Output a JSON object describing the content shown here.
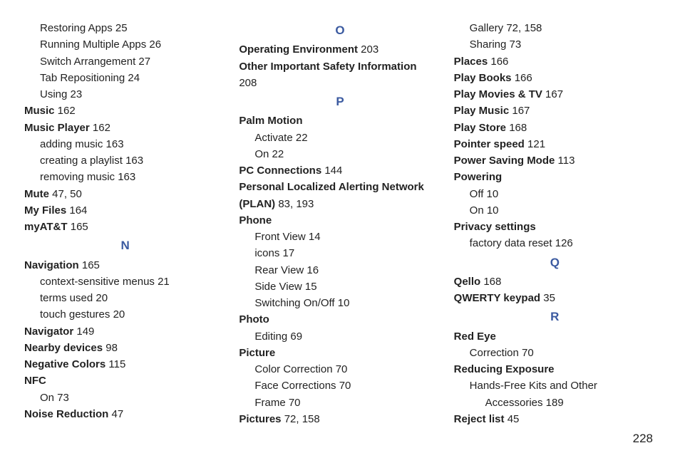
{
  "page_number": "228",
  "columns": [
    {
      "items": [
        {
          "kind": "sub",
          "indent": 1,
          "text": "Restoring Apps",
          "pages": " 25"
        },
        {
          "kind": "sub",
          "indent": 1,
          "text": "Running Multiple Apps",
          "pages": " 26"
        },
        {
          "kind": "sub",
          "indent": 1,
          "text": "Switch Arrangement",
          "pages": " 27"
        },
        {
          "kind": "sub",
          "indent": 1,
          "text": "Tab Repositioning",
          "pages": " 24"
        },
        {
          "kind": "sub",
          "indent": 1,
          "text": "Using",
          "pages": " 23"
        },
        {
          "kind": "term",
          "indent": 0,
          "text": "Music",
          "pages": " 162"
        },
        {
          "kind": "term",
          "indent": 0,
          "text": "Music Player",
          "pages": " 162"
        },
        {
          "kind": "sub",
          "indent": 1,
          "text": "adding music",
          "pages": " 163"
        },
        {
          "kind": "sub",
          "indent": 1,
          "text": "creating a playlist",
          "pages": " 163"
        },
        {
          "kind": "sub",
          "indent": 1,
          "text": "removing music",
          "pages": " 163"
        },
        {
          "kind": "term",
          "indent": 0,
          "text": "Mute",
          "pages": " 47,  50"
        },
        {
          "kind": "term",
          "indent": 0,
          "text": "My Files",
          "pages": " 164"
        },
        {
          "kind": "term",
          "indent": 0,
          "text": "myAT&T",
          "pages": " 165"
        },
        {
          "kind": "letter",
          "text": "N"
        },
        {
          "kind": "term",
          "indent": 0,
          "text": "Navigation",
          "pages": " 165"
        },
        {
          "kind": "sub",
          "indent": 1,
          "text": "context-sensitive menus",
          "pages": " 21"
        },
        {
          "kind": "sub",
          "indent": 1,
          "text": "terms used",
          "pages": " 20"
        },
        {
          "kind": "sub",
          "indent": 1,
          "text": "touch gestures",
          "pages": " 20"
        },
        {
          "kind": "term",
          "indent": 0,
          "text": "Navigator",
          "pages": " 149"
        },
        {
          "kind": "term",
          "indent": 0,
          "text": "Nearby devices",
          "pages": " 98"
        },
        {
          "kind": "term",
          "indent": 0,
          "text": "Negative Colors",
          "pages": " 115"
        },
        {
          "kind": "term",
          "indent": 0,
          "text": "NFC",
          "pages": ""
        },
        {
          "kind": "sub",
          "indent": 1,
          "text": "On",
          "pages": " 73"
        },
        {
          "kind": "term",
          "indent": 0,
          "text": "Noise Reduction",
          "pages": " 47"
        }
      ]
    },
    {
      "items": [
        {
          "kind": "letter",
          "text": "O"
        },
        {
          "kind": "term",
          "indent": 0,
          "text": "Operating Environment",
          "pages": " 203"
        },
        {
          "kind": "term",
          "indent": 0,
          "text": "Other Important Safety Information",
          "pages": ""
        },
        {
          "kind": "sub",
          "indent": 0,
          "text": "208",
          "pages": ""
        },
        {
          "kind": "letter",
          "text": "P"
        },
        {
          "kind": "term",
          "indent": 0,
          "text": "Palm Motion",
          "pages": ""
        },
        {
          "kind": "sub",
          "indent": 1,
          "text": "Activate",
          "pages": " 22"
        },
        {
          "kind": "sub",
          "indent": 1,
          "text": "On",
          "pages": " 22"
        },
        {
          "kind": "term",
          "indent": 0,
          "text": "PC Connections",
          "pages": " 144"
        },
        {
          "kind": "term",
          "indent": 0,
          "text": "Personal Localized Alerting Network (PLAN)",
          "pages": " 83,  193"
        },
        {
          "kind": "term",
          "indent": 0,
          "text": "Phone",
          "pages": ""
        },
        {
          "kind": "sub",
          "indent": 1,
          "text": "Front View",
          "pages": " 14"
        },
        {
          "kind": "sub",
          "indent": 1,
          "text": "icons",
          "pages": " 17"
        },
        {
          "kind": "sub",
          "indent": 1,
          "text": "Rear View",
          "pages": " 16"
        },
        {
          "kind": "sub",
          "indent": 1,
          "text": "Side View",
          "pages": " 15"
        },
        {
          "kind": "sub",
          "indent": 1,
          "text": "Switching On/Off",
          "pages": " 10"
        },
        {
          "kind": "term",
          "indent": 0,
          "text": "Photo",
          "pages": ""
        },
        {
          "kind": "sub",
          "indent": 1,
          "text": "Editing",
          "pages": " 69"
        },
        {
          "kind": "term",
          "indent": 0,
          "text": "Picture",
          "pages": ""
        },
        {
          "kind": "sub",
          "indent": 1,
          "text": "Color Correction",
          "pages": " 70"
        },
        {
          "kind": "sub",
          "indent": 1,
          "text": "Face Corrections",
          "pages": " 70"
        },
        {
          "kind": "sub",
          "indent": 1,
          "text": "Frame",
          "pages": " 70"
        },
        {
          "kind": "term",
          "indent": 0,
          "text": "Pictures",
          "pages": " 72,  158"
        }
      ]
    },
    {
      "items": [
        {
          "kind": "sub",
          "indent": 1,
          "text": "Gallery",
          "pages": " 72,  158"
        },
        {
          "kind": "sub",
          "indent": 1,
          "text": "Sharing",
          "pages": " 73"
        },
        {
          "kind": "term",
          "indent": 0,
          "text": "Places",
          "pages": " 166"
        },
        {
          "kind": "term",
          "indent": 0,
          "text": "Play Books",
          "pages": " 166"
        },
        {
          "kind": "term",
          "indent": 0,
          "text": "Play Movies & TV",
          "pages": " 167"
        },
        {
          "kind": "term",
          "indent": 0,
          "text": "Play Music",
          "pages": " 167"
        },
        {
          "kind": "term",
          "indent": 0,
          "text": "Play Store",
          "pages": " 168"
        },
        {
          "kind": "term",
          "indent": 0,
          "text": "Pointer speed",
          "pages": " 121"
        },
        {
          "kind": "term",
          "indent": 0,
          "text": "Power Saving Mode",
          "pages": " 113"
        },
        {
          "kind": "term",
          "indent": 0,
          "text": "Powering",
          "pages": ""
        },
        {
          "kind": "sub",
          "indent": 1,
          "text": "Off",
          "pages": " 10"
        },
        {
          "kind": "sub",
          "indent": 1,
          "text": "On",
          "pages": " 10"
        },
        {
          "kind": "term",
          "indent": 0,
          "text": "Privacy settings",
          "pages": ""
        },
        {
          "kind": "sub",
          "indent": 1,
          "text": "factory data reset",
          "pages": " 126"
        },
        {
          "kind": "letter",
          "text": "Q"
        },
        {
          "kind": "term",
          "indent": 0,
          "text": "Qello",
          "pages": " 168"
        },
        {
          "kind": "term",
          "indent": 0,
          "text": "QWERTY keypad",
          "pages": " 35"
        },
        {
          "kind": "letter",
          "text": "R"
        },
        {
          "kind": "term",
          "indent": 0,
          "text": "Red Eye",
          "pages": ""
        },
        {
          "kind": "sub",
          "indent": 1,
          "text": "Correction",
          "pages": " 70"
        },
        {
          "kind": "term",
          "indent": 0,
          "text": "Reducing Exposure",
          "pages": ""
        },
        {
          "kind": "sub",
          "indent": 1,
          "text": "Hands-Free Kits and Other",
          "pages": ""
        },
        {
          "kind": "sub",
          "indent": 2,
          "text": "Accessories",
          "pages": " 189"
        },
        {
          "kind": "term",
          "indent": 0,
          "text": "Reject list",
          "pages": " 45"
        }
      ]
    }
  ]
}
